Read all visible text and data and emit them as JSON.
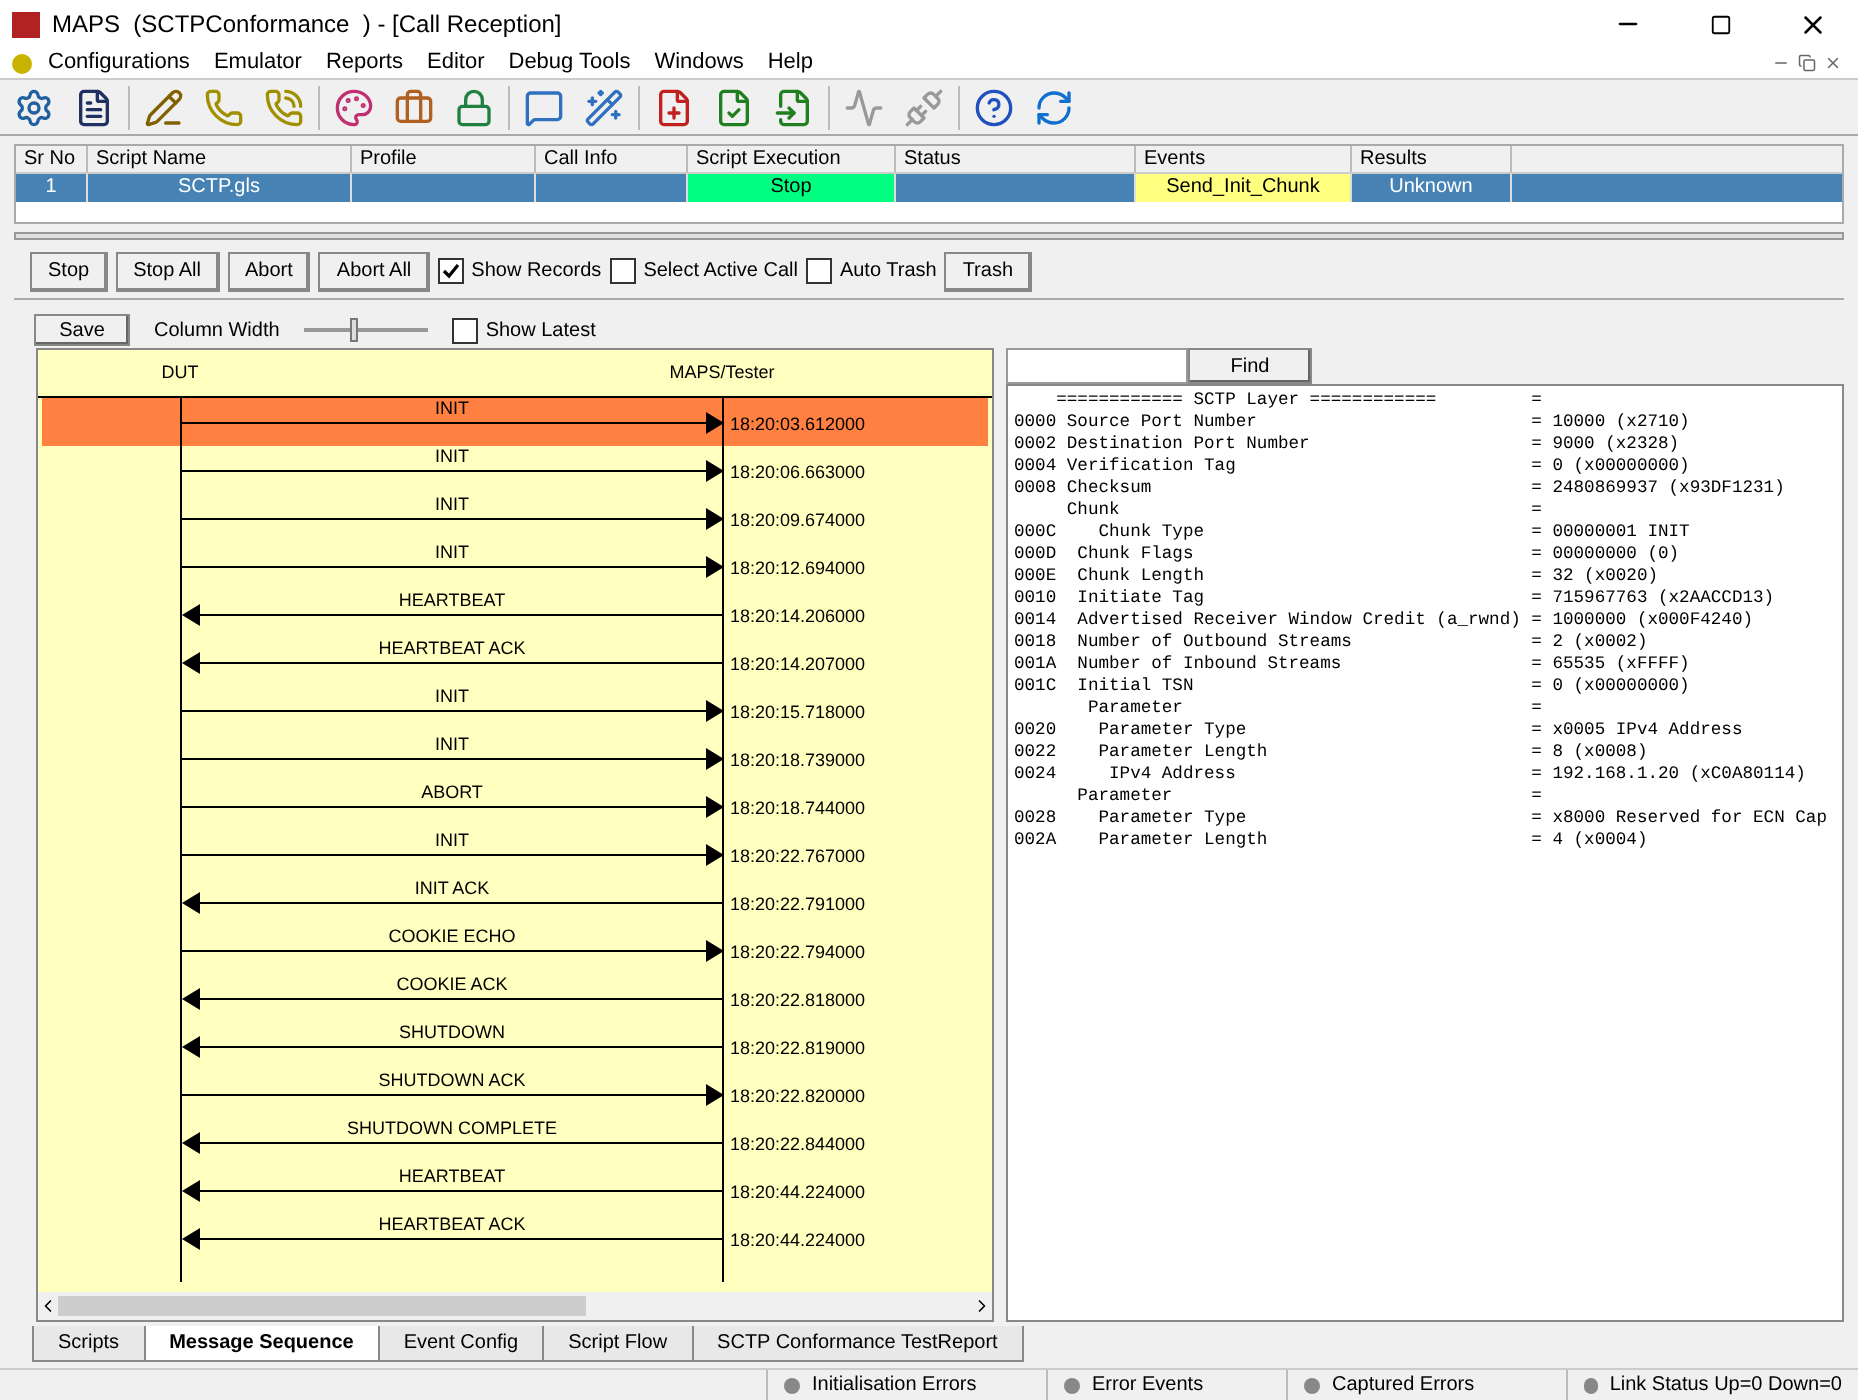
{
  "window": {
    "title": "MAPS  (SCTPConformance  ) - [Call Reception]"
  },
  "menu": [
    "Configurations",
    "Emulator",
    "Reports",
    "Editor",
    "Debug Tools",
    "Windows",
    "Help"
  ],
  "table": {
    "columns": [
      "Sr No",
      "Script Name",
      "Profile",
      "Call Info",
      "Script Execution",
      "Status",
      "Events",
      "Results"
    ],
    "rows": [
      {
        "selected": true,
        "cells": [
          {
            "text": "1"
          },
          {
            "text": "SCTP.gls"
          },
          {
            "text": ""
          },
          {
            "text": ""
          },
          {
            "text": "Stop",
            "color": "#00ff80"
          },
          {
            "text": ""
          },
          {
            "text": "Send_Init_Chunk",
            "color": "#ffff80"
          },
          {
            "text": "Unknown",
            "color": "#4682b4"
          }
        ]
      }
    ]
  },
  "controls": [
    {
      "kind": "button",
      "label": "Stop"
    },
    {
      "kind": "button",
      "label": "Stop All"
    },
    {
      "kind": "button",
      "label": "Abort"
    },
    {
      "kind": "button",
      "label": "Abort All"
    },
    {
      "kind": "checkbox",
      "label": "Show Records",
      "checked": true
    },
    {
      "kind": "checkbox",
      "label": "Select Active Call",
      "checked": false
    },
    {
      "kind": "checkbox",
      "label": "Auto Trash",
      "checked": false
    },
    {
      "kind": "button",
      "label": "Trash"
    }
  ],
  "view_controls": {
    "save": "Save",
    "column_width": {
      "label": "Column Width",
      "level": 0.4
    },
    "show_latest": {
      "label": "Show Latest",
      "checked": false
    }
  },
  "ladder": {
    "left": "DUT",
    "right": "MAPS/Tester",
    "messages": [
      {
        "label": "INIT",
        "time": "18:20:03.612000",
        "kind": "rightward",
        "selected": true
      },
      {
        "label": "INIT",
        "time": "18:20:06.663000",
        "kind": "rightward",
        "selected": false
      },
      {
        "label": "INIT",
        "time": "18:20:09.674000",
        "kind": "rightward",
        "selected": false
      },
      {
        "label": "INIT",
        "time": "18:20:12.694000",
        "kind": "rightward",
        "selected": false
      },
      {
        "label": "HEARTBEAT",
        "time": "18:20:14.206000",
        "kind": "leftward",
        "selected": false
      },
      {
        "label": "HEARTBEAT ACK",
        "time": "18:20:14.207000",
        "kind": "leftward",
        "selected": false
      },
      {
        "label": "INIT",
        "time": "18:20:15.718000",
        "kind": "rightward",
        "selected": false
      },
      {
        "label": "INIT",
        "time": "18:20:18.739000",
        "kind": "rightward",
        "selected": false
      },
      {
        "label": "ABORT",
        "time": "18:20:18.744000",
        "kind": "rightward",
        "selected": false
      },
      {
        "label": "INIT",
        "time": "18:20:22.767000",
        "kind": "rightward",
        "selected": false
      },
      {
        "label": "INIT ACK",
        "time": "18:20:22.791000",
        "kind": "leftward",
        "selected": false
      },
      {
        "label": "COOKIE ECHO",
        "time": "18:20:22.794000",
        "kind": "rightward",
        "selected": false
      },
      {
        "label": "COOKIE ACK",
        "time": "18:20:22.818000",
        "kind": "leftward",
        "selected": false
      },
      {
        "label": "SHUTDOWN",
        "time": "18:20:22.819000",
        "kind": "leftward",
        "selected": false
      },
      {
        "label": "SHUTDOWN ACK",
        "time": "18:20:22.820000",
        "kind": "rightward",
        "selected": false
      },
      {
        "label": "SHUTDOWN COMPLETE",
        "time": "18:20:22.844000",
        "kind": "leftward",
        "selected": false
      },
      {
        "label": "HEARTBEAT",
        "time": "18:20:44.224000",
        "kind": "leftward",
        "selected": false
      },
      {
        "label": "HEARTBEAT ACK",
        "time": "18:20:44.224000",
        "kind": "leftward",
        "selected": false
      }
    ]
  },
  "decode": {
    "find_button": "Find",
    "lines": [
      {
        "field": "    ============ SCTP Layer ============",
        "value": "="
      },
      {
        "field": "0000 Source Port Number",
        "value": "= 10000 (x2710)"
      },
      {
        "field": "0002 Destination Port Number",
        "value": "= 9000 (x2328)"
      },
      {
        "field": "0004 Verification Tag",
        "value": "= 0 (x00000000)"
      },
      {
        "field": "0008 Checksum",
        "value": "= 2480869937 (x93DF1231)"
      },
      {
        "field": "     Chunk",
        "value": "="
      },
      {
        "field": "000C    Chunk Type",
        "value": "= 00000001 INIT"
      },
      {
        "field": "000D  Chunk Flags",
        "value": "= 00000000 (0)"
      },
      {
        "field": "000E  Chunk Length",
        "value": "= 32 (x0020)"
      },
      {
        "field": "0010  Initiate Tag",
        "value": "= 715967763 (x2AACCD13)"
      },
      {
        "field": "0014  Advertised Receiver Window Credit (a_rwnd)",
        "value": "= 1000000 (x000F4240)"
      },
      {
        "field": "0018  Number of Outbound Streams",
        "value": "= 2 (x0002)"
      },
      {
        "field": "001A  Number of Inbound Streams",
        "value": "= 65535 (xFFFF)"
      },
      {
        "field": "001C  Initial TSN",
        "value": "= 0 (x00000000)"
      },
      {
        "field": "       Parameter",
        "value": "="
      },
      {
        "field": "0020    Parameter Type",
        "value": "= x0005 IPv4 Address"
      },
      {
        "field": "0022    Parameter Length",
        "value": "= 8 (x0008)"
      },
      {
        "field": "0024     IPv4 Address",
        "value": "= 192.168.1.20 (xC0A80114)"
      },
      {
        "field": "      Parameter",
        "value": "="
      },
      {
        "field": "0028    Parameter Type",
        "value": "= x8000 Reserved for ECN Cap"
      },
      {
        "field": "002A    Parameter Length",
        "value": "= 4 (x0004)"
      }
    ]
  },
  "tabs": [
    {
      "label": "Scripts",
      "selected": false
    },
    {
      "label": "Message Sequence",
      "selected": true
    },
    {
      "label": "Event Config",
      "selected": false
    },
    {
      "label": "Script Flow",
      "selected": false
    },
    {
      "label": "SCTP Conformance TestReport",
      "selected": false
    }
  ],
  "status_bar": [
    "Initialisation Errors",
    "Error Events",
    "Captured Errors",
    "Link Status Up=0 Down=0"
  ]
}
